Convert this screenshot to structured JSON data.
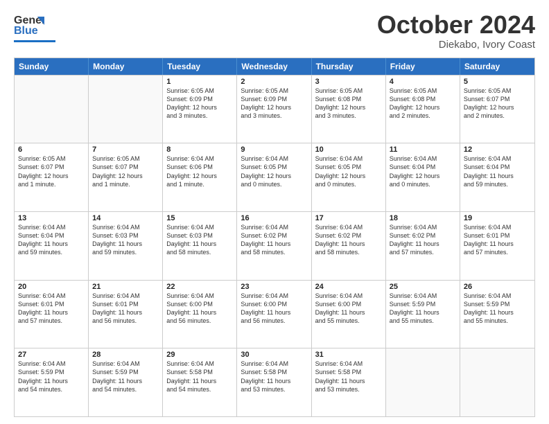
{
  "logo": {
    "line1": "General",
    "line2": "Blue"
  },
  "title": "October 2024",
  "subtitle": "Diekabo, Ivory Coast",
  "weekdays": [
    "Sunday",
    "Monday",
    "Tuesday",
    "Wednesday",
    "Thursday",
    "Friday",
    "Saturday"
  ],
  "rows": [
    [
      {
        "day": "",
        "info": ""
      },
      {
        "day": "",
        "info": ""
      },
      {
        "day": "1",
        "info": "Sunrise: 6:05 AM\nSunset: 6:09 PM\nDaylight: 12 hours\nand 3 minutes."
      },
      {
        "day": "2",
        "info": "Sunrise: 6:05 AM\nSunset: 6:09 PM\nDaylight: 12 hours\nand 3 minutes."
      },
      {
        "day": "3",
        "info": "Sunrise: 6:05 AM\nSunset: 6:08 PM\nDaylight: 12 hours\nand 3 minutes."
      },
      {
        "day": "4",
        "info": "Sunrise: 6:05 AM\nSunset: 6:08 PM\nDaylight: 12 hours\nand 2 minutes."
      },
      {
        "day": "5",
        "info": "Sunrise: 6:05 AM\nSunset: 6:07 PM\nDaylight: 12 hours\nand 2 minutes."
      }
    ],
    [
      {
        "day": "6",
        "info": "Sunrise: 6:05 AM\nSunset: 6:07 PM\nDaylight: 12 hours\nand 1 minute."
      },
      {
        "day": "7",
        "info": "Sunrise: 6:05 AM\nSunset: 6:07 PM\nDaylight: 12 hours\nand 1 minute."
      },
      {
        "day": "8",
        "info": "Sunrise: 6:04 AM\nSunset: 6:06 PM\nDaylight: 12 hours\nand 1 minute."
      },
      {
        "day": "9",
        "info": "Sunrise: 6:04 AM\nSunset: 6:05 PM\nDaylight: 12 hours\nand 0 minutes."
      },
      {
        "day": "10",
        "info": "Sunrise: 6:04 AM\nSunset: 6:05 PM\nDaylight: 12 hours\nand 0 minutes."
      },
      {
        "day": "11",
        "info": "Sunrise: 6:04 AM\nSunset: 6:04 PM\nDaylight: 12 hours\nand 0 minutes."
      },
      {
        "day": "12",
        "info": "Sunrise: 6:04 AM\nSunset: 6:04 PM\nDaylight: 11 hours\nand 59 minutes."
      }
    ],
    [
      {
        "day": "13",
        "info": "Sunrise: 6:04 AM\nSunset: 6:04 PM\nDaylight: 11 hours\nand 59 minutes."
      },
      {
        "day": "14",
        "info": "Sunrise: 6:04 AM\nSunset: 6:03 PM\nDaylight: 11 hours\nand 59 minutes."
      },
      {
        "day": "15",
        "info": "Sunrise: 6:04 AM\nSunset: 6:03 PM\nDaylight: 11 hours\nand 58 minutes."
      },
      {
        "day": "16",
        "info": "Sunrise: 6:04 AM\nSunset: 6:02 PM\nDaylight: 11 hours\nand 58 minutes."
      },
      {
        "day": "17",
        "info": "Sunrise: 6:04 AM\nSunset: 6:02 PM\nDaylight: 11 hours\nand 58 minutes."
      },
      {
        "day": "18",
        "info": "Sunrise: 6:04 AM\nSunset: 6:02 PM\nDaylight: 11 hours\nand 57 minutes."
      },
      {
        "day": "19",
        "info": "Sunrise: 6:04 AM\nSunset: 6:01 PM\nDaylight: 11 hours\nand 57 minutes."
      }
    ],
    [
      {
        "day": "20",
        "info": "Sunrise: 6:04 AM\nSunset: 6:01 PM\nDaylight: 11 hours\nand 57 minutes."
      },
      {
        "day": "21",
        "info": "Sunrise: 6:04 AM\nSunset: 6:01 PM\nDaylight: 11 hours\nand 56 minutes."
      },
      {
        "day": "22",
        "info": "Sunrise: 6:04 AM\nSunset: 6:00 PM\nDaylight: 11 hours\nand 56 minutes."
      },
      {
        "day": "23",
        "info": "Sunrise: 6:04 AM\nSunset: 6:00 PM\nDaylight: 11 hours\nand 56 minutes."
      },
      {
        "day": "24",
        "info": "Sunrise: 6:04 AM\nSunset: 6:00 PM\nDaylight: 11 hours\nand 55 minutes."
      },
      {
        "day": "25",
        "info": "Sunrise: 6:04 AM\nSunset: 5:59 PM\nDaylight: 11 hours\nand 55 minutes."
      },
      {
        "day": "26",
        "info": "Sunrise: 6:04 AM\nSunset: 5:59 PM\nDaylight: 11 hours\nand 55 minutes."
      }
    ],
    [
      {
        "day": "27",
        "info": "Sunrise: 6:04 AM\nSunset: 5:59 PM\nDaylight: 11 hours\nand 54 minutes."
      },
      {
        "day": "28",
        "info": "Sunrise: 6:04 AM\nSunset: 5:59 PM\nDaylight: 11 hours\nand 54 minutes."
      },
      {
        "day": "29",
        "info": "Sunrise: 6:04 AM\nSunset: 5:58 PM\nDaylight: 11 hours\nand 54 minutes."
      },
      {
        "day": "30",
        "info": "Sunrise: 6:04 AM\nSunset: 5:58 PM\nDaylight: 11 hours\nand 53 minutes."
      },
      {
        "day": "31",
        "info": "Sunrise: 6:04 AM\nSunset: 5:58 PM\nDaylight: 11 hours\nand 53 minutes."
      },
      {
        "day": "",
        "info": ""
      },
      {
        "day": "",
        "info": ""
      }
    ]
  ]
}
